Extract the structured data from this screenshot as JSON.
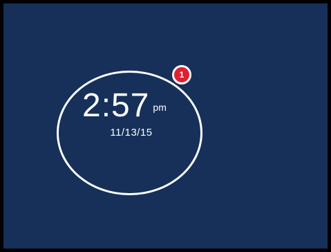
{
  "clock": {
    "time": "2:57",
    "ampm": "pm",
    "date": "11/13/15"
  },
  "notification": {
    "count": "1"
  },
  "colors": {
    "background": "#16305a",
    "ring": "#ffffff",
    "badge": "#e02030",
    "text": "#ffffff",
    "frame": "#000000"
  }
}
